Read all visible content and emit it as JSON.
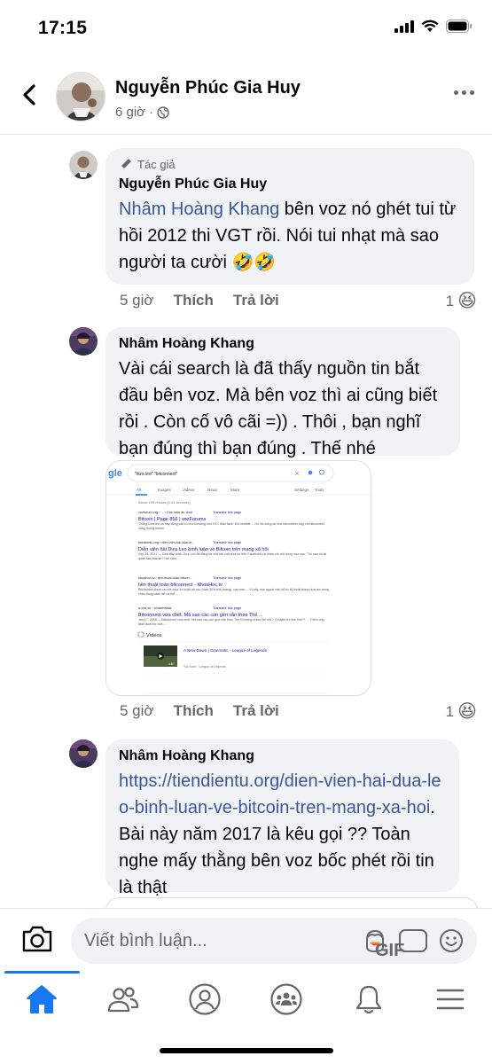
{
  "status_bar": {
    "time": "17:15"
  },
  "header": {
    "name": "Nguyễn Phúc Gia Huy",
    "time": "6 giờ",
    "separator": "·"
  },
  "comments": [
    {
      "badge": "Tác giả",
      "name": "Nguyễn Phúc Gia Huy",
      "mention": "Nhâm Hoàng Khang",
      "text": "bên voz nó ghét tui từ hồi 2012 thi VGT rồi. Nói tui nhạt mà sao người ta cười",
      "emoji": "🤣🤣",
      "time": "5 giờ",
      "like": "Thích",
      "reply": "Trả lời",
      "reaction_count": "1",
      "reaction_emoji": "😆"
    },
    {
      "name": "Nhâm Hoàng Khang",
      "text": "Vài cái search là đã thấy nguồn tin bắt đầu bên voz. Mà bên voz thì ai cũng biết rồi . Còn cố vô cãi =)) . Thôi , bạn nghĩ bạn đúng thì bạn đúng . Thế nhé",
      "time": "5 giờ",
      "like": "Thích",
      "reply": "Trả lời",
      "reaction_count": "1",
      "reaction_emoji": "😆",
      "screenshot": {
        "query": "\"dưa leo\" \"bitconnect\"",
        "tabs": [
          "All",
          "Images",
          "Videos",
          "News",
          "More",
          "Settings",
          "Tools"
        ],
        "result_count": "About 205 results (0.41 seconds)",
        "results": [
          {
            "url": "vozforum.org › ... › Các môn ăn chơi",
            "translate": "Translate this page",
            "title": "Bitcoin | Page 856 | vozForums",
            "snippet": "Thằng Dưa leo có hay động vấn rủ chơi lending con HXT thần face. Em newbie ... rồi, đồ cũng lại như bitconbest ông nhỉ bitconnect cũng mừng ieeeei."
          },
          {
            "url": "tiendientu.org › dien-vien-hai-dua-le...",
            "translate": "Translate this page",
            "title": "Diễn viên hài Dưa Leo bình luận về Bitcoin trên mạng xã hội",
            "snippet": "Sep 25, 2017 — Gần đây nhất, Dưa Leo đã đăng tải một bài viết chia sẻ trên Facebook cá nhân với nội dung như sau: \"Tụi sao tui lại quan tâm bitcoin? Hồi năm..."
          },
          {
            "url": "khoahoc.tv › tien-thuat-toan-bitcon...",
            "translate": "Translate this page",
            "title": "tiền thuật toán bitconnect - KhoaHoc.tv",
            "snippet": "Bitconnect được ra một mức lời suất rất cao (hơn 30% mỗi tháng), cao hơn ... Vì vậy, mọi người nên bỏ từ kỹ thuật trồng dưa leo trong chậu đúng cách để có thể ..."
          },
          {
            "url": "a.vnd.vn › showthread",
            "translate": "Translate this page",
            "title": "Bitconnect vừa chết. Mà sao các con giời vẫn theo Thế ...",
            "snippet": "Jan 17, 2018 — Bitconnect vừa chết. Mà sao các con giời vẫn theo Thế Khương nhiều thế nhỉ ? Chuyện trò linh tinh™ ... Thêm ông thần dưa leo vừa ..."
          }
        ],
        "videos_label": "Videos",
        "video_title": "A New Dawn | Cinematic - League of Legends",
        "video_source": "YouTube · League of Legends",
        "video_duration": "4:57"
      }
    },
    {
      "name": "Nhâm Hoàng Khang",
      "link": "https://tiendientu.org/dien-vien-hai-dua-leo-binh-luan-ve-bitcoin-tren-mang-xa-hoi",
      "text": "Bài này năm 2017 là kêu gọi ?? Toàn nghe mấy thằng bên voz bốc phét rồi tin là thật"
    }
  ],
  "composer": {
    "placeholder": "Viết bình luận...",
    "gif_label": "GIF"
  },
  "colors": {
    "link": "#385898",
    "brand": "#1877f2",
    "bubble": "#f0f2f5",
    "secondary_text": "#65676b"
  }
}
